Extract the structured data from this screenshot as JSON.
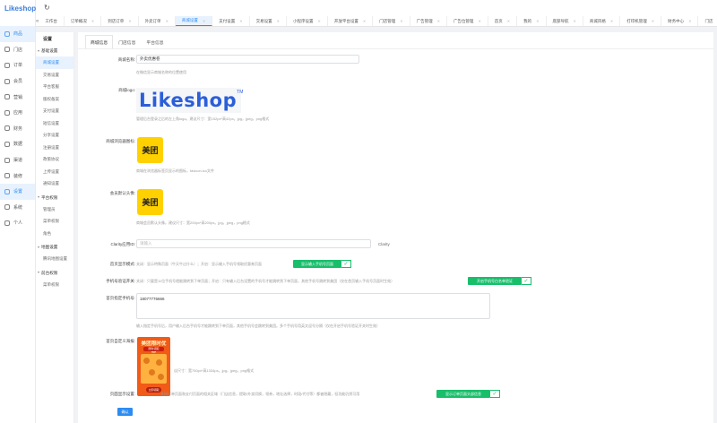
{
  "app": {
    "logo_text": "Likeshop",
    "logo_mark": "®"
  },
  "leftnav": [
    {
      "label": "商品",
      "icon": "goods-icon",
      "active": true
    },
    {
      "label": "门店",
      "icon": "store-icon"
    },
    {
      "label": "订单",
      "icon": "order-icon"
    },
    {
      "label": "会员",
      "icon": "member-icon"
    },
    {
      "label": "营销",
      "icon": "marketing-icon"
    },
    {
      "label": "应用",
      "icon": "app-icon"
    },
    {
      "label": "财务",
      "icon": "finance-icon"
    },
    {
      "label": "数据",
      "icon": "data-icon"
    },
    {
      "label": "渠道",
      "icon": "channel-icon"
    },
    {
      "label": "装修",
      "icon": "decorate-icon"
    },
    {
      "label": "设置",
      "icon": "settings-icon",
      "active2": true
    },
    {
      "label": "系统",
      "icon": "system-icon"
    },
    {
      "label": "个人",
      "icon": "user-icon"
    }
  ],
  "topbar": {
    "refresh_icon": "refresh-icon"
  },
  "tabs": [
    {
      "label": "工作台"
    },
    {
      "label": "订单概况"
    },
    {
      "label": "到店订单"
    },
    {
      "label": "外卖订单"
    },
    {
      "label": "商城设置",
      "active": true
    },
    {
      "label": "支付设置"
    },
    {
      "label": "交易设置"
    },
    {
      "label": "小程序设置"
    },
    {
      "label": "开放平台设置"
    },
    {
      "label": "门店管理"
    },
    {
      "label": "广告管理"
    },
    {
      "label": "广告位管理"
    },
    {
      "label": "首页"
    },
    {
      "label": "我的"
    },
    {
      "label": "底部导航"
    },
    {
      "label": "商城风格"
    },
    {
      "label": "打印机管理"
    },
    {
      "label": "财务中心"
    },
    {
      "label": "门店"
    }
  ],
  "sidebar": {
    "title": "设置",
    "groups": [
      {
        "label": "基础设置",
        "items": [
          "商城设置",
          "交易设置",
          "平台客服",
          "版权备案",
          "支付设置",
          "短信设置",
          "分享设置",
          "注册设置",
          "政策协议",
          "上传设置",
          "通知设置"
        ]
      },
      {
        "label": "平台权限",
        "items": [
          "管理员",
          "菜单权限",
          "角色"
        ]
      },
      {
        "label": "地图设置",
        "items": [
          "腾讯地图设置"
        ]
      },
      {
        "label": "前台权限",
        "items": [
          "菜单权限"
        ]
      }
    ]
  },
  "page_tabs": [
    "商城信息",
    "门店信息",
    "平台信息"
  ],
  "form": {
    "shop_name_label": "商城名称:",
    "shop_name_value": "外卖优惠卷",
    "shop_name_hint": "在微信显示商城名称的位置使用",
    "logo_label": "商城logo:",
    "logo_text": "Likeshop",
    "logo_tm": "TM",
    "logo_hint": "管理后台登录之后的左上角logo。建议尺寸：宽152px*高42px。jpg，jpeg，png格式",
    "favicon_label": "商城浏览器图标:",
    "meituan_text": "美团",
    "favicon_hint": "商城在浏览器标签页显示的图标，favicon.ico文件",
    "avatar_label": "会员默认头像:",
    "avatar_hint": "商城会员默认头像。建议尺寸：宽200px*高200px。jpg，jpeg，png格式",
    "clarity_label": "Clarity应用ID:",
    "clarity_placeholder": "请输入",
    "clarity_suffix": "Clarity",
    "homepage_label": "首页显示模式:",
    "homepage_text": "关闭：显示特殊页面（牛天牛过什么）；开启：显示输入手机号领取优惠券页面",
    "homepage_btn": "显示输入手机号页面",
    "phone_verify_label": "手机号验证开关:",
    "phone_verify_text": "关闭：只要是11位手机号就能跳转到下单页面；开启：只有输入后台设置的手机号才能跳转到下单页面，其他手机号跳转到美团（仅在首页输入手机号页面时生效）",
    "phone_verify_btn": "开启手机号白名单验证",
    "phone_list_label": "首页指定手机号:",
    "phone_list_value": "18077776666",
    "phone_list_hint": "输入指定手机号后，用户输入后台手机号才能跳转到下单页面，其他手机号会跳转到美团。多个手机号用英文逗号分隔（仅在开启手机号验证开关时生效）",
    "poster_label": "首页自定义海报:",
    "poster_title": "美团限时优惠",
    "poster_sub": "限时领取",
    "poster_btn": "立即领取",
    "poster_hint": "议尺寸：宽750px*高1334px。jpg，jpeg，png格式",
    "orderpage_label": "页面显示设置:",
    "orderpage_text": "关闭订单页面和支付页面的相关区域（门店信息，提取/外卖切换，领券，地址选择，时段/代付等）都被隐藏，但功能仍然可用",
    "orderpage_btn": "显示订单页面头部信息",
    "submit": "确认"
  },
  "colors": {
    "primary": "#2d8cf0",
    "switch_on": "#19be6b",
    "meituan_yellow": "#ffd100"
  }
}
